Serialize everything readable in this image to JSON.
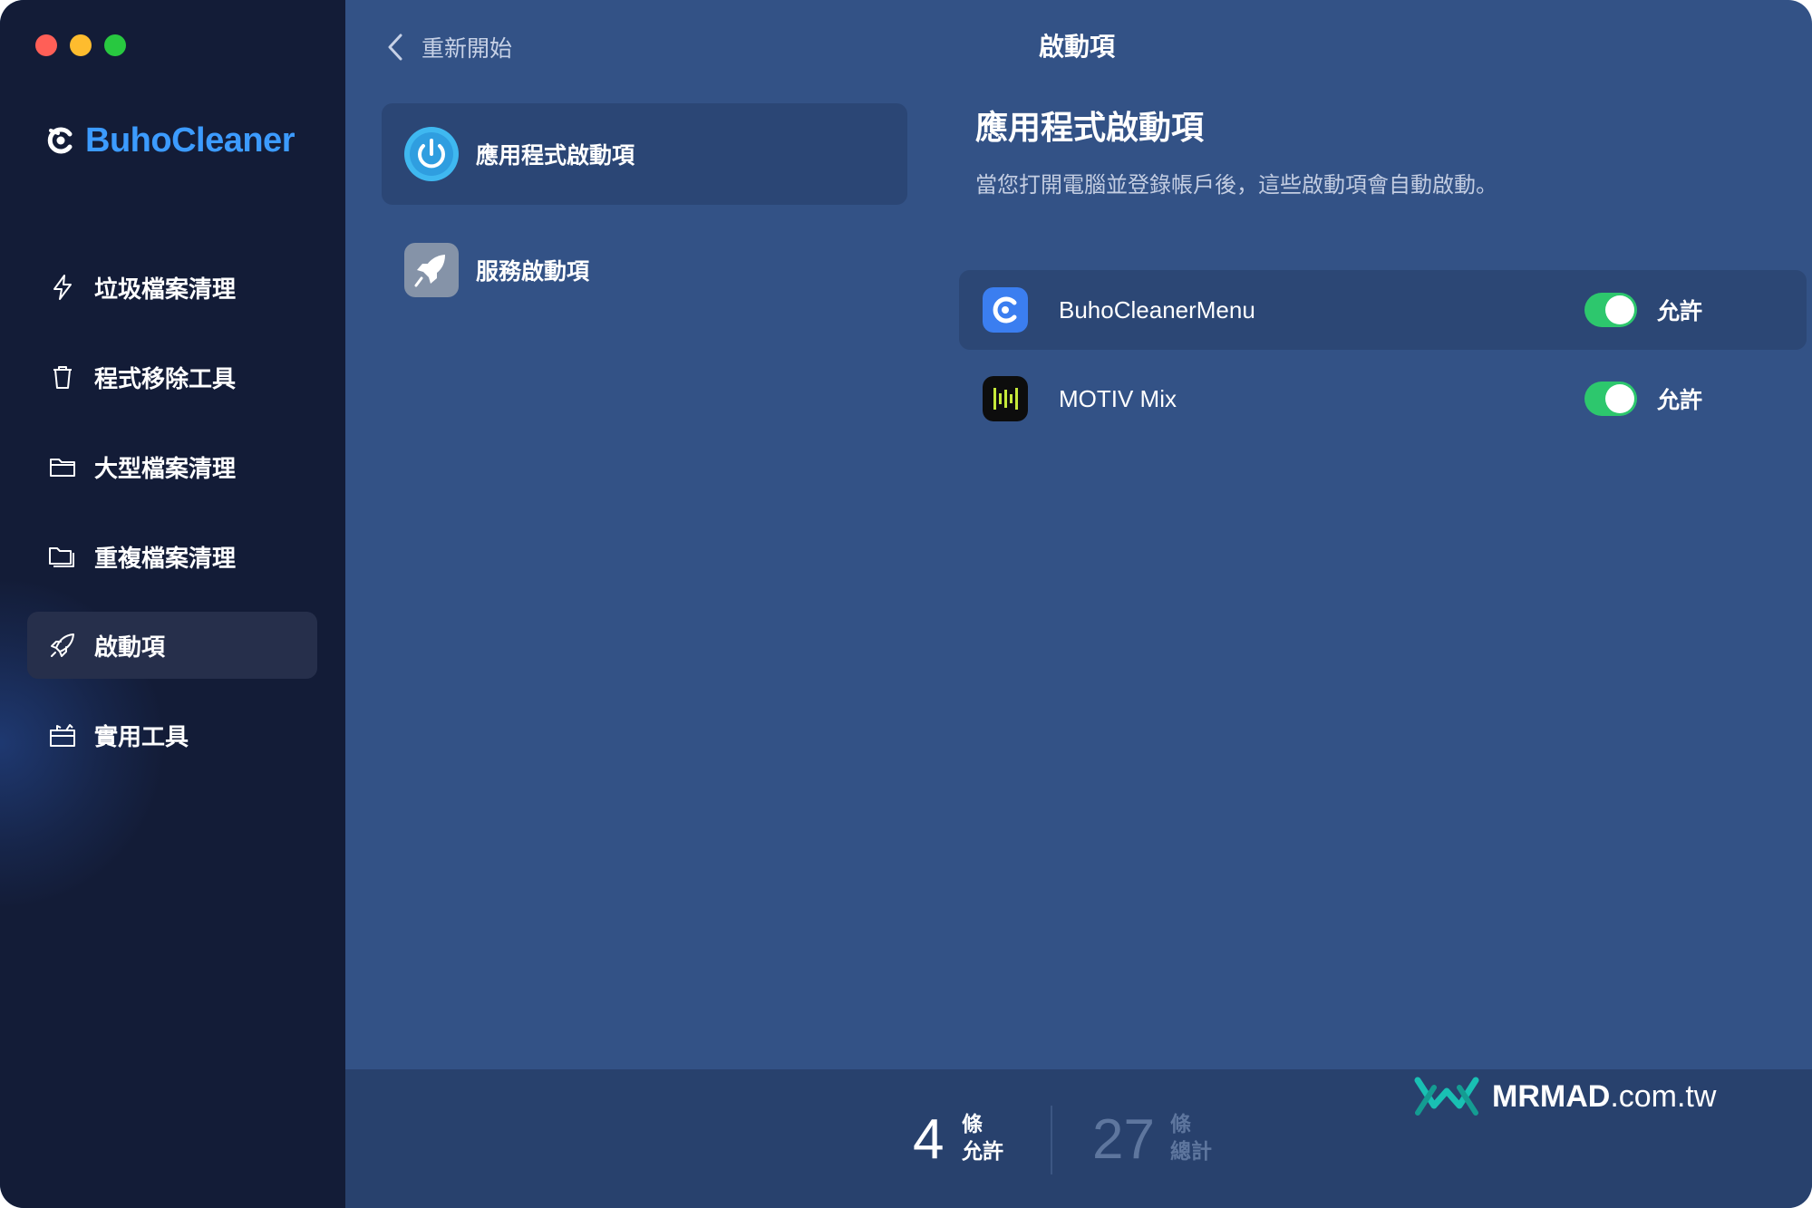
{
  "window": {
    "title": "啟動項"
  },
  "sidebar": {
    "brand": "BuhoCleaner",
    "items": [
      {
        "label": "垃圾檔案清理",
        "icon": "bolt-icon",
        "active": false
      },
      {
        "label": "程式移除工具",
        "icon": "trash-icon",
        "active": false
      },
      {
        "label": "大型檔案清理",
        "icon": "folder-icon",
        "active": false
      },
      {
        "label": "重複檔案清理",
        "icon": "duplicate-folder-icon",
        "active": false
      },
      {
        "label": "啟動項",
        "icon": "rocket-icon",
        "active": true
      },
      {
        "label": "實用工具",
        "icon": "toolbox-icon",
        "active": false
      }
    ]
  },
  "header": {
    "back_label": "重新開始"
  },
  "categories": [
    {
      "label": "應用程式啟動項",
      "icon": "power-icon",
      "active": true
    },
    {
      "label": "服務啟動項",
      "icon": "rocket-icon",
      "active": false
    }
  ],
  "panel": {
    "title": "應用程式啟動項",
    "description": "當您打開電腦並登錄帳戶後，這些啟動項會自動啟動。",
    "items": [
      {
        "name": "BuhoCleanerMenu",
        "icon": "buhocleaner-app-icon",
        "enabled": true,
        "status": "允許"
      },
      {
        "name": "MOTIV Mix",
        "icon": "motiv-mix-app-icon",
        "enabled": true,
        "status": "允許"
      }
    ]
  },
  "footer": {
    "allowed_count": "4",
    "allowed_unit": "條",
    "allowed_label": "允許",
    "total_count": "27",
    "total_unit": "條",
    "total_label": "總計"
  },
  "watermark": {
    "brand": "MRMAD",
    "suffix": ".com.tw"
  },
  "colors": {
    "sidebar_bg": "#131c37",
    "main_bg": "#335286",
    "accent_blue": "#3c9bff",
    "toggle_on": "#2dc76d",
    "footer_bg": "#28416d"
  }
}
